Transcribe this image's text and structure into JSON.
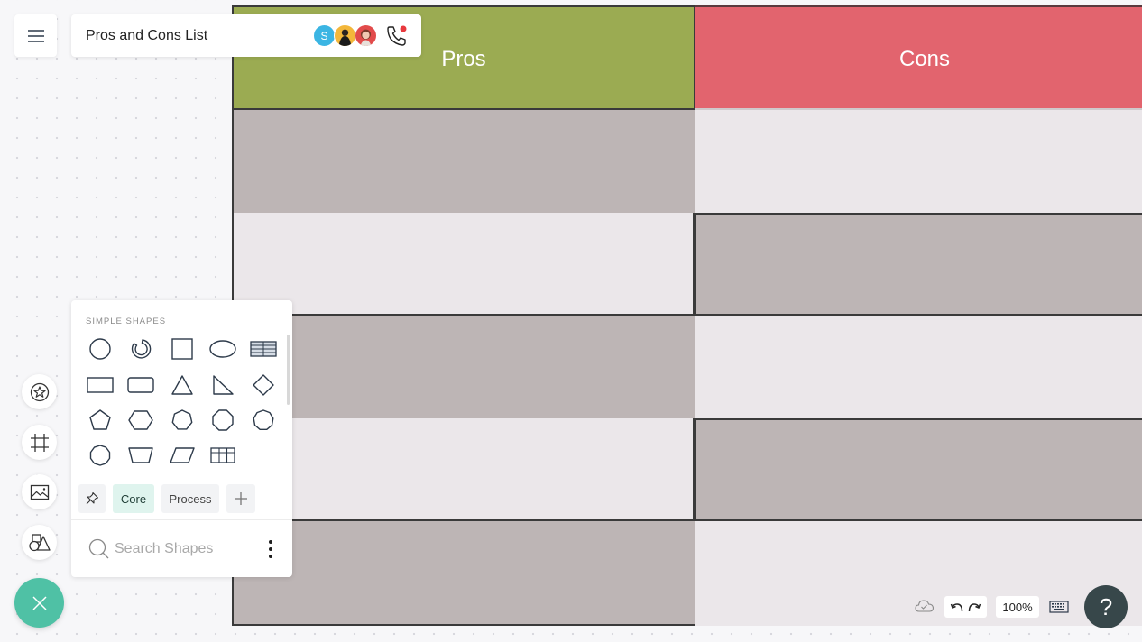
{
  "document": {
    "title": "Pros and Cons List"
  },
  "collaborators": [
    {
      "initial": "S",
      "color": "#3bb5e3"
    },
    {
      "initial": "",
      "color": "#f3b73a"
    },
    {
      "initial": "",
      "color": "#e24b4b"
    }
  ],
  "table": {
    "columns": [
      {
        "label": "Pros",
        "color": "#9bab52"
      },
      {
        "label": "Cons",
        "color": "#e2646e"
      }
    ],
    "rows": [
      {
        "pros": "",
        "cons": ""
      },
      {
        "pros": "",
        "cons": ""
      },
      {
        "pros": "",
        "cons": ""
      },
      {
        "pros": "",
        "cons": ""
      },
      {
        "pros": "",
        "cons": ""
      }
    ]
  },
  "shapes_panel": {
    "section_title": "SIMPLE SHAPES",
    "shapes": [
      "circle",
      "arc",
      "square",
      "ellipse",
      "table-striped",
      "rectangle",
      "rounded-rectangle",
      "triangle",
      "right-triangle",
      "diamond",
      "pentagon",
      "hexagon",
      "heptagon",
      "octagon",
      "nonagon",
      "decagon",
      "trapezoid",
      "parallelogram",
      "table-grid"
    ],
    "tabs": {
      "core": "Core",
      "process": "Process"
    },
    "search_placeholder": "Search Shapes"
  },
  "toolbar": {
    "zoom_level": "100%",
    "help_label": "?"
  },
  "colors": {
    "accent": "#4fc1a5",
    "row_dark": "#bdb5b5",
    "row_light": "#ebe7ea",
    "help_bg": "#37474a"
  }
}
